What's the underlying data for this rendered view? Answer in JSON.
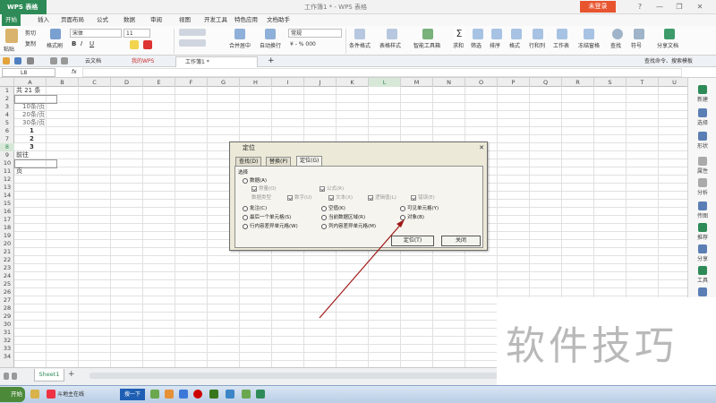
{
  "titlebar": {
    "app_button": "WPS 表格",
    "doc_title": "工作簿1 * - WPS 表格",
    "login_button": "未登录",
    "controls": [
      "?",
      "—",
      "❐",
      "✕"
    ]
  },
  "menu": [
    "开始",
    "插入",
    "页面布局",
    "公式",
    "数据",
    "审阅",
    "视图",
    "开发工具",
    "特色应用",
    "文档助手"
  ],
  "ribbon": {
    "clipboard": {
      "cut": "剪切",
      "copy": "复制",
      "format_painter": "格式刷",
      "paste": "粘贴"
    },
    "font_name": "宋体",
    "font_size": "11",
    "bold": "B",
    "italic": "I",
    "underline": "U",
    "merge_center": "合并居中",
    "wrap_text": "自动换行",
    "number_format": "常规",
    "percent": "¥ - % 000",
    "tools": [
      "条件格式",
      "表格样式",
      "智能工具箱",
      "求和",
      "筛选",
      "排序",
      "格式",
      "行和列",
      "工作表",
      "冻结窗格",
      "查找",
      "符号",
      "分享文档"
    ]
  },
  "tabbar": {
    "tabs": [
      "云文档",
      "我的WPS",
      "工作簿1 *"
    ],
    "add": "+",
    "search_hint": "查找命令、搜索模板"
  },
  "formula": {
    "name_box": "L8",
    "fx": "fx"
  },
  "columns": [
    "A",
    "B",
    "C",
    "D",
    "E",
    "F",
    "G",
    "H",
    "I",
    "J",
    "K",
    "L",
    "M",
    "N",
    "O",
    "P",
    "Q",
    "R",
    "S",
    "T",
    "U"
  ],
  "rows": [
    "1",
    "2",
    "3",
    "4",
    "5",
    "6",
    "7",
    "8",
    "9",
    "10",
    "11",
    "12",
    "13",
    "14",
    "15",
    "16",
    "17",
    "18",
    "19",
    "20",
    "21",
    "22",
    "23",
    "24",
    "25",
    "26",
    "27",
    "28",
    "29",
    "30",
    "31",
    "32",
    "33",
    "34"
  ],
  "cells": {
    "a1": "共 21 条",
    "a3": "10条/页",
    "a4": "20条/页",
    "a5": "30条/页",
    "a6": "1",
    "a7": "2",
    "a8": "3",
    "a9": "前往",
    "a11": "页"
  },
  "sidebar": [
    "新建",
    "选择",
    "形状",
    "属性",
    "分析",
    "传图",
    "推荐",
    "分享",
    "工具",
    "备份"
  ],
  "sheetbar": {
    "sheet": "Sheet1",
    "add": "+"
  },
  "taskbar": {
    "start": "开始",
    "task1": "斗地主在线",
    "task2": "搜一下"
  },
  "dialog": {
    "title": "定位",
    "close": "✕",
    "tabs": [
      "查找(D)",
      "替换(P)",
      "定位(G)"
    ],
    "group": "选择",
    "data_radio": "数据(A)",
    "const": "常量(O)",
    "formula_chk": "公式(R)",
    "data_type": "数据类型",
    "number": "数字(U)",
    "text": "文本(X)",
    "logic": "逻辑值(L)",
    "error": "错误(E)",
    "comments": "批注(C)",
    "blanks": "空值(K)",
    "visible_cells": "可见单元格(Y)",
    "last_cell": "最后一个单元格(S)",
    "current_region": "当前数据区域(R)",
    "objects": "对象(B)",
    "row_diff": "行内容差异单元格(W)",
    "col_diff": "列内容差异单元格(M)",
    "ok": "定位(T)",
    "close_btn": "关闭"
  },
  "watermark": "软件技巧"
}
